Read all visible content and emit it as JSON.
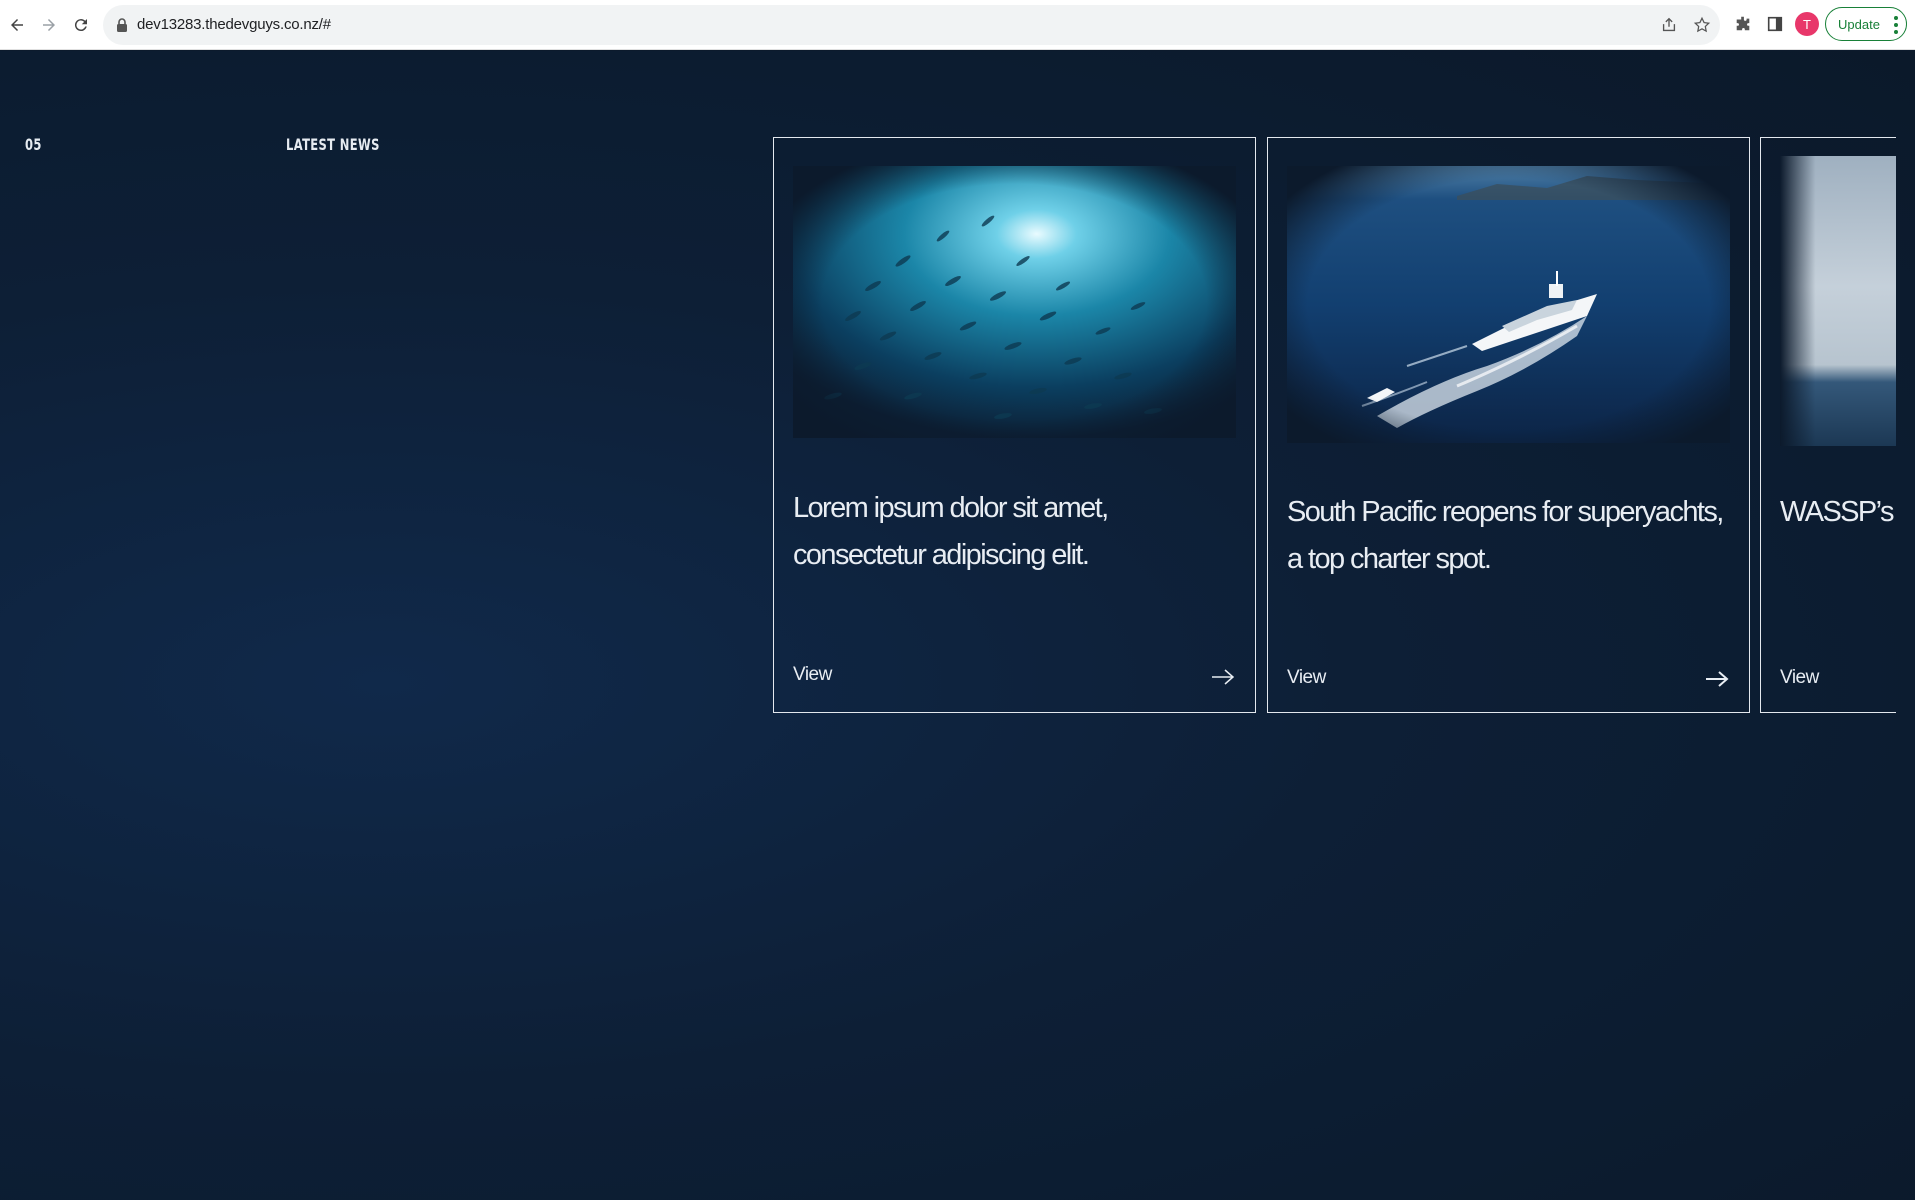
{
  "browser": {
    "url": "dev13283.thedevguys.co.nz/#",
    "avatar_letter": "T",
    "update_label": "Update"
  },
  "section": {
    "number": "05",
    "title": "LATEST NEWS"
  },
  "cards": [
    {
      "title": "Lorem ipsum dolor sit amet, consectetur adipiscing elit.",
      "link_label": "View",
      "image": "fish-school-underwater"
    },
    {
      "title": "South Pacific reopens for superyachts, a top charter spot.",
      "link_label": "View",
      "image": "superyacht-aerial"
    },
    {
      "title": "WASSP’s E advanceme",
      "link_label": "View",
      "image": "ocean-sky"
    }
  ],
  "colors": {
    "background": "#0c1a2c",
    "card_border": "#e3e8ee",
    "text": "#e8edf3",
    "update_green": "#188038"
  }
}
